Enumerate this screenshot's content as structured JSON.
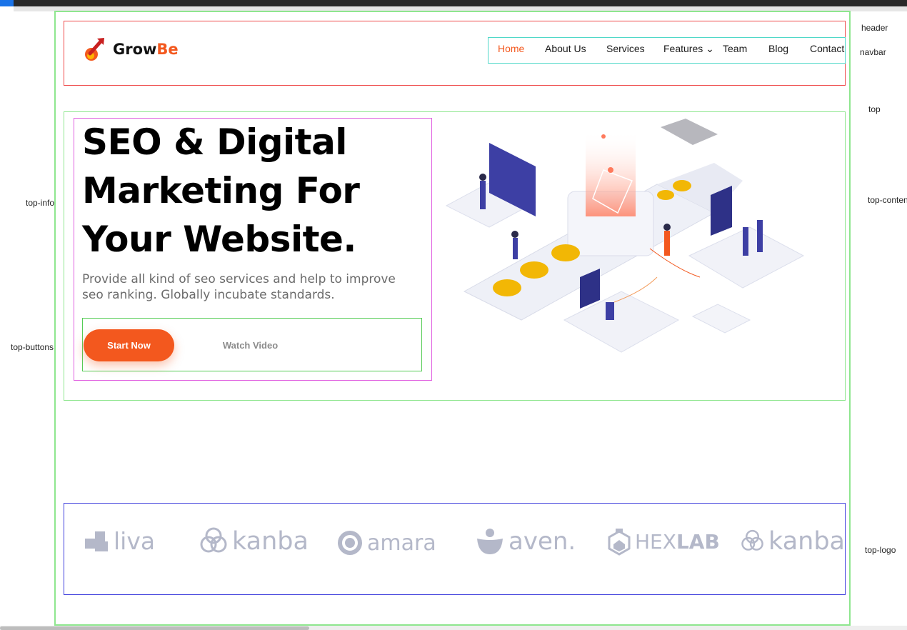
{
  "brand": {
    "name_main": "Grow",
    "name_accent": "Be"
  },
  "navbar": {
    "items": [
      {
        "label": "Home",
        "active": true
      },
      {
        "label": "About Us"
      },
      {
        "label": "Services"
      },
      {
        "label": "Features ⌄"
      },
      {
        "label": "Team"
      },
      {
        "label": "Blog"
      },
      {
        "label": "Contact"
      }
    ]
  },
  "hero": {
    "title": "SEO & Digital Marketing For Your Website.",
    "subtitle": "Provide all kind of seo services and help to improve seo ranking. Globally incubate standards.",
    "start_label": "Start Now",
    "video_label": "Watch Video"
  },
  "partners": [
    {
      "name": "liva",
      "icon": "liva-icon"
    },
    {
      "name": "kanba",
      "icon": "kanba-icon"
    },
    {
      "name": "amara",
      "icon": "amara-icon"
    },
    {
      "name": "aven.",
      "icon": "aven-icon"
    },
    {
      "name_light": "HEX",
      "name_bold": "LAB",
      "icon": "hexlab-icon"
    },
    {
      "name": "kanba",
      "icon": "kanba-icon"
    }
  ],
  "debug_labels": {
    "header": "header",
    "navbar": "navbar",
    "top": "top",
    "top_info": "top-info",
    "top_content": "top-content",
    "top_buttons": "top-buttons",
    "top_logo": "top-logo"
  },
  "colors": {
    "accent": "#f3581e",
    "partner_gray": "#b4b8c9"
  }
}
